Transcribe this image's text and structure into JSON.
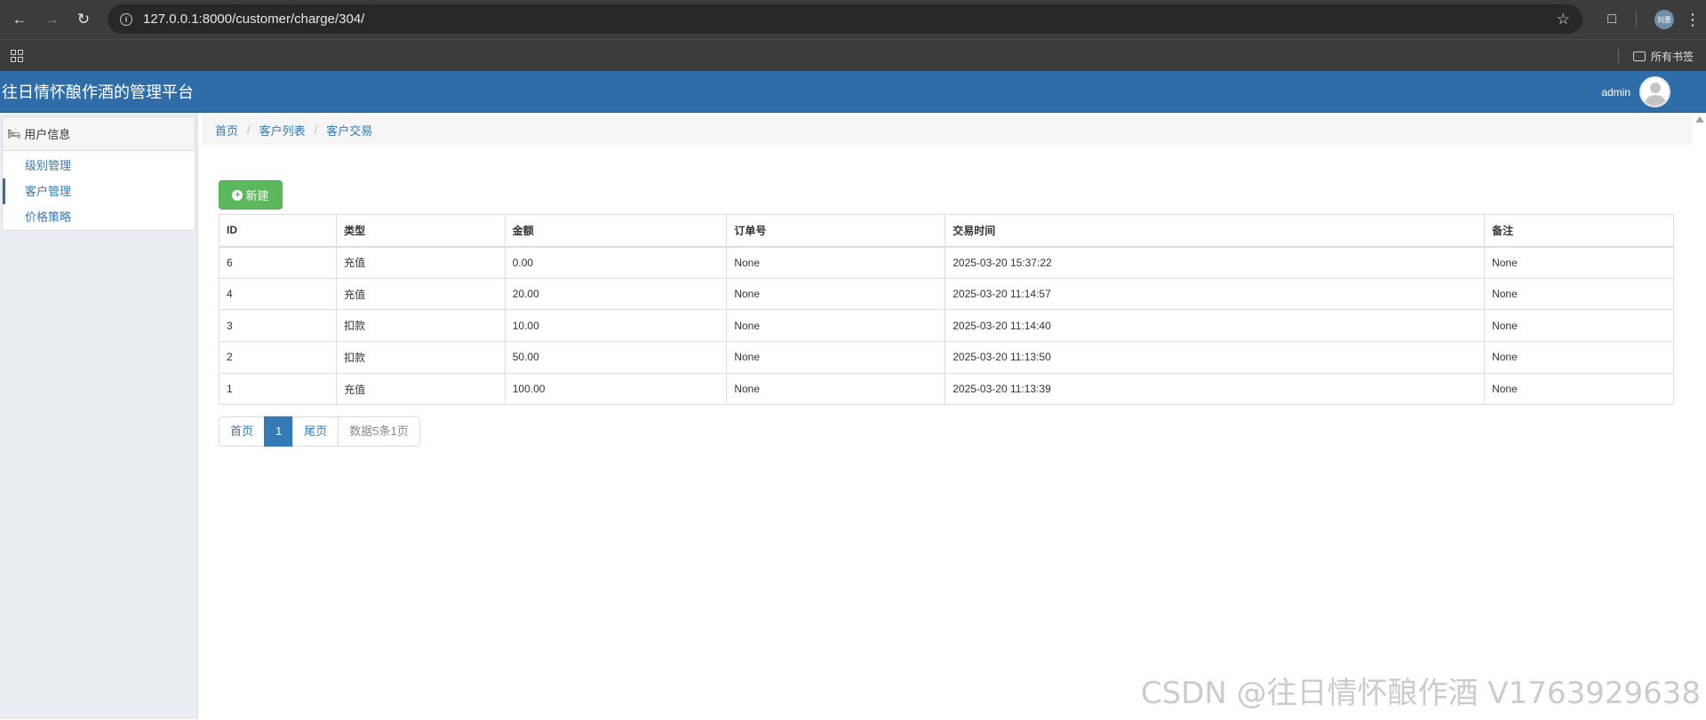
{
  "browser": {
    "url": "127.0.0.1:8000/customer/charge/304/",
    "profile_label": "刘惠",
    "bookmarks_label": "所有书签"
  },
  "app": {
    "brand": "往日情怀酿作酒的管理平台",
    "user": "admin"
  },
  "sidebar": {
    "heading": "用户信息",
    "items": [
      {
        "label": "级别管理"
      },
      {
        "label": "客户管理"
      },
      {
        "label": "价格策略"
      }
    ]
  },
  "breadcrumb": [
    "首页",
    "客户列表",
    "客户交易"
  ],
  "toolbar": {
    "new_label": "新建"
  },
  "table": {
    "headers": [
      "ID",
      "类型",
      "金额",
      "订单号",
      "交易时间",
      "备注"
    ],
    "rows": [
      [
        "6",
        "充值",
        "0.00",
        "None",
        "2025-03-20 15:37:22",
        "None"
      ],
      [
        "4",
        "充值",
        "20.00",
        "None",
        "2025-03-20 11:14:57",
        "None"
      ],
      [
        "3",
        "扣款",
        "10.00",
        "None",
        "2025-03-20 11:14:40",
        "None"
      ],
      [
        "2",
        "扣款",
        "50.00",
        "None",
        "2025-03-20 11:13:50",
        "None"
      ],
      [
        "1",
        "充值",
        "100.00",
        "None",
        "2025-03-20 11:13:39",
        "None"
      ]
    ]
  },
  "pagination": {
    "first": "首页",
    "current": "1",
    "last": "尾页",
    "info": "数据5条1页"
  },
  "watermark": "CSDN @往日情怀酿作酒 V1763929638",
  "colors": {
    "header_bg": "#2e6da8",
    "new_button": "#5cb85c",
    "link": "#337ab7",
    "active_page": "#337ab7"
  }
}
